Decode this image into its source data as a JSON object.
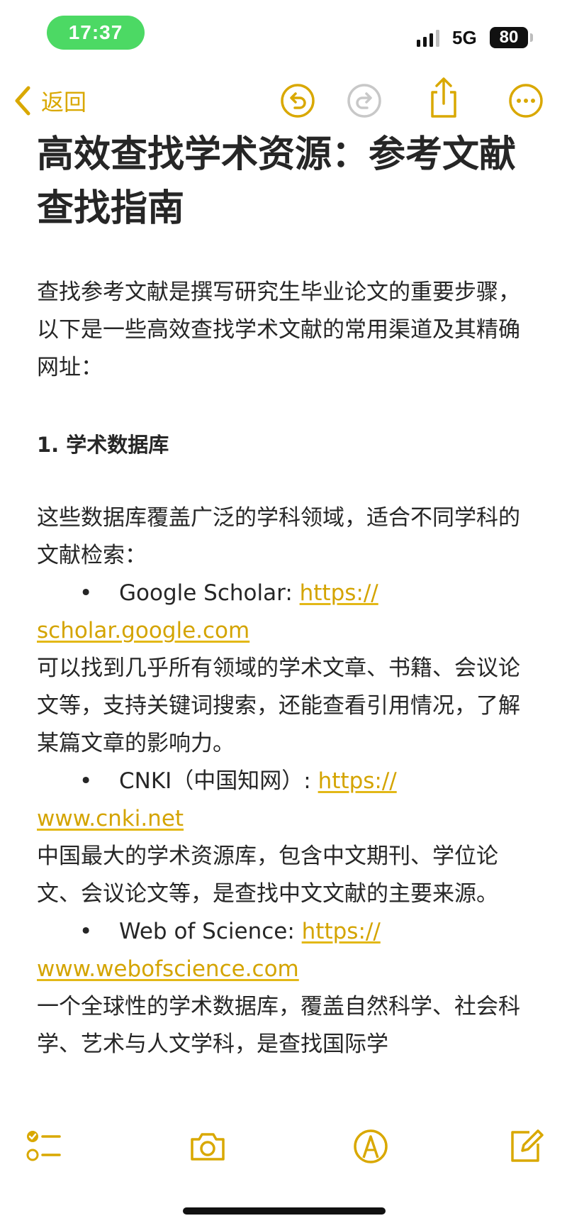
{
  "status_bar": {
    "time": "17:37",
    "network": "5G",
    "battery": "80"
  },
  "nav": {
    "back_label": "返回"
  },
  "note": {
    "title": "高效查找学术资源：参考文献查找指南",
    "intro": "查找参考文献是撰写研究生毕业论文的重要步骤，以下是一些高效查找学术文献的常用渠道及其精确网址：",
    "section_heading": "1. 学术数据库",
    "section_desc": "这些数据库覆盖广泛的学科领域，适合不同学科的文献检索：",
    "bullet_char": "•",
    "resources": [
      {
        "name": "Google Scholar: ",
        "url_part1": "https://",
        "url_part2": "scholar.google.com",
        "description": "可以找到几乎所有领域的学术文章、书籍、会议论文等，支持关键词搜索，还能查看引用情况，了解某篇文章的影响力。"
      },
      {
        "name": "CNKI（中国知网）: ",
        "url_part1": "https://",
        "url_part2": "www.cnki.net",
        "description": "中国最大的学术资源库，包含中文期刊、学位论文、会议论文等，是查找中文文献的主要来源。"
      },
      {
        "name": "Web of Science: ",
        "url_part1": "https://",
        "url_part2": "www.webofscience.com",
        "description": "一个全球性的学术数据库，覆盖自然科学、社会科学、艺术与人文学科，是查找国际学"
      }
    ]
  },
  "colors": {
    "accent": "#d9a800",
    "time_pill": "#4cd964",
    "text": "#262626"
  },
  "icons": {
    "nav": [
      "chevron-left-icon",
      "undo-icon",
      "redo-icon",
      "share-icon",
      "more-icon"
    ],
    "toolbar": [
      "checklist-icon",
      "camera-icon",
      "markup-icon",
      "compose-icon"
    ]
  }
}
